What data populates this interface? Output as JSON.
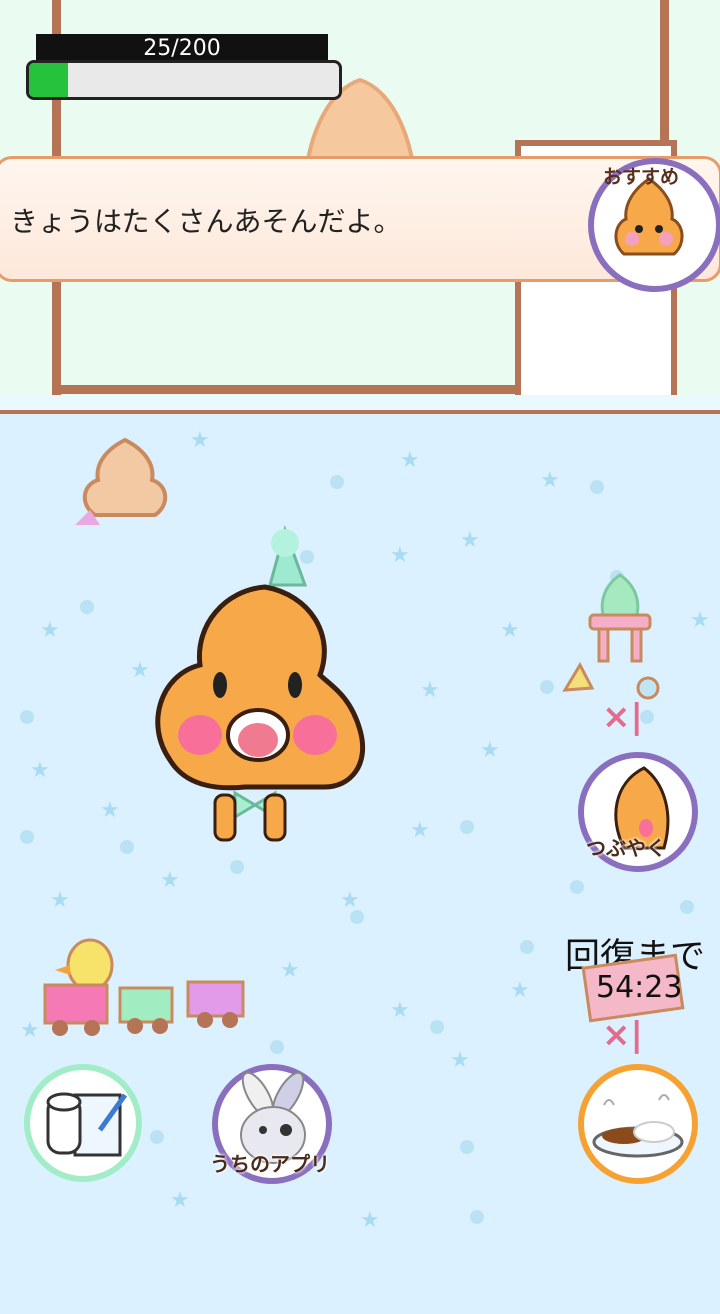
{
  "level": {
    "current": 25,
    "max": 200,
    "label": "25/200",
    "progress": 0.125
  },
  "message": {
    "text": "きょうはたくさんあそんだよ。",
    "recommend_label": "おすすめ"
  },
  "buttons": {
    "tweet_label": "つぶやく",
    "our_apps_label": "うちのアプリ"
  },
  "recovery": {
    "title": "回復まで",
    "time": "54:23"
  },
  "counts": {
    "toy_count_mark": "×|",
    "food_count_mark": "×|"
  },
  "icons": [
    "notebook-icon",
    "bunny-icon",
    "curry-icon",
    "poop-character",
    "duck-train-icon",
    "chair-icon"
  ],
  "colors": {
    "accent_purple": "#8b6fbf",
    "level_green": "#26c23b",
    "message_border": "#e79b6a"
  }
}
